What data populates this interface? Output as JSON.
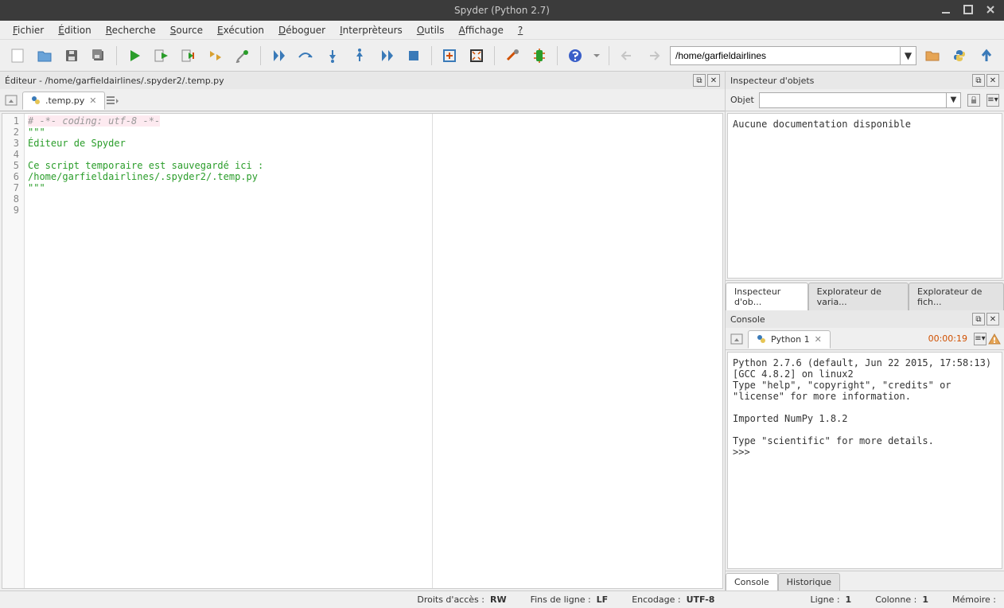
{
  "window": {
    "title": "Spyder (Python 2.7)"
  },
  "menu": [
    "Fichier",
    "Édition",
    "Recherche",
    "Source",
    "Exécution",
    "Déboguer",
    "Interprèteurs",
    "Outils",
    "Affichage",
    "?"
  ],
  "path": "/home/garfieldairlines",
  "editor": {
    "header": "Éditeur - /home/garfieldairlines/.spyder2/.temp.py",
    "tab": ".temp.py",
    "lines": {
      "l1": "# -*- coding: utf-8 -*-",
      "l2": "\"\"\"",
      "l3": "Éditeur de Spyder",
      "l4": "",
      "l5": "Ce script temporaire est sauvegardé ici :",
      "l6": "/home/garfieldairlines/.spyder2/.temp.py",
      "l7": "\"\"\"",
      "l8": "",
      "l9": ""
    }
  },
  "inspector": {
    "header": "Inspecteur d'objets",
    "objet_label": "Objet",
    "doc_text": "Aucune documentation disponible",
    "tabs": {
      "a": "Inspecteur d'ob...",
      "b": "Explorateur de varia...",
      "c": "Explorateur de fich..."
    }
  },
  "console": {
    "header": "Console",
    "tab": "Python 1",
    "timer": "00:00:19",
    "output": "Python 2.7.6 (default, Jun 22 2015, 17:58:13)\n[GCC 4.8.2] on linux2\nType \"help\", \"copyright\", \"credits\" or \"license\" for more information.\n\nImported NumPy 1.8.2\n\nType \"scientific\" for more details.\n>>> ",
    "tabs": {
      "a": "Console",
      "b": "Historique"
    }
  },
  "status": {
    "perm_label": "Droits d'accès :",
    "perm_value": "RW",
    "eol_label": "Fins de ligne :",
    "eol_value": "LF",
    "enc_label": "Encodage :",
    "enc_value": "UTF-8",
    "line_label": "Ligne :",
    "line_value": "1",
    "col_label": "Colonne :",
    "col_value": "1",
    "mem_label": "Mémoire :"
  }
}
